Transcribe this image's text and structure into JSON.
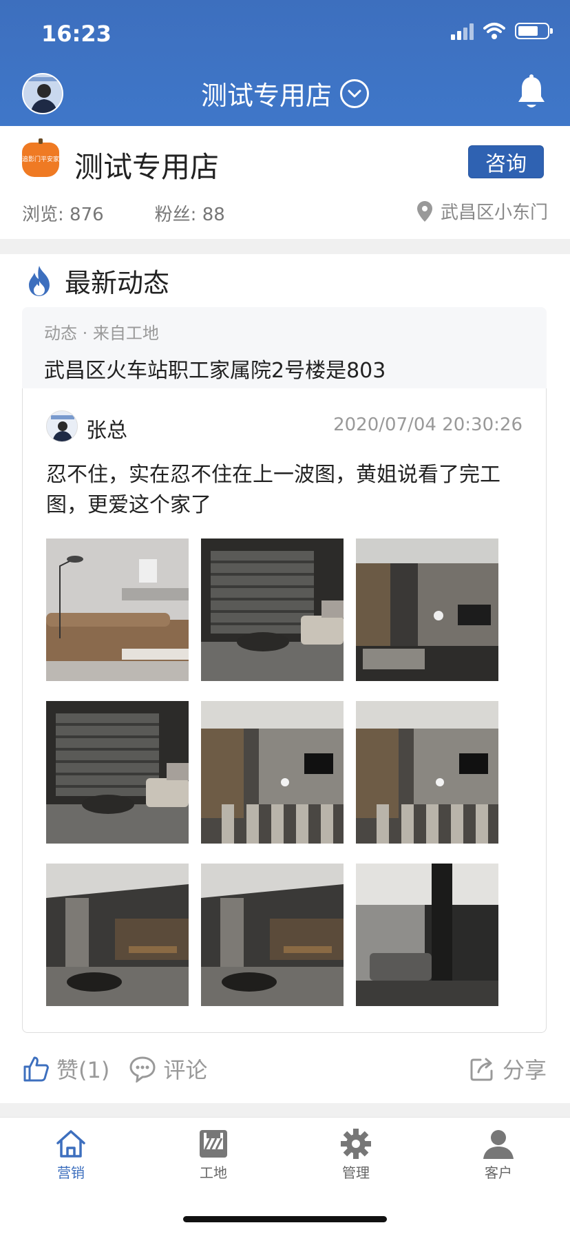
{
  "status_bar": {
    "time": "16:23"
  },
  "header": {
    "shop_selector": "测试专用店"
  },
  "shop": {
    "name": "测试专用店",
    "logo_text": "追影门平安家",
    "consult_label": "咨询",
    "views_label": "浏览:",
    "views": "876",
    "fans_label": "粉丝:",
    "fans": "88",
    "location": "武昌区小东门"
  },
  "feed": {
    "title": "最新动态",
    "post": {
      "meta": "动态 · 来自工地",
      "address": "武昌区火车站职工家属院2号楼是803",
      "author": "张总",
      "time": "2020/07/04 20:30:26",
      "text": "忍不住，实在忍不住在上一波图，黄姐说看了完工图，更爱这个家了",
      "like_label": "赞(1)",
      "comment_label": "评论",
      "share_label": "分享"
    }
  },
  "tabs": [
    {
      "label": "营销",
      "icon": "home-icon"
    },
    {
      "label": "工地",
      "icon": "construction-icon"
    },
    {
      "label": "管理",
      "icon": "gear-icon"
    },
    {
      "label": "客户",
      "icon": "person-icon"
    }
  ],
  "colors": {
    "brand": "#3d6fbe",
    "button": "#2f62b2",
    "flame": "#3d6fbe"
  }
}
